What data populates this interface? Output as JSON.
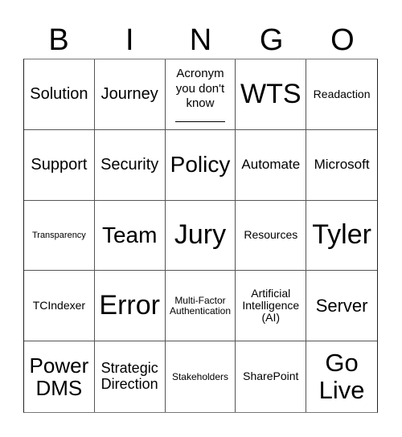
{
  "header": {
    "letters": [
      "B",
      "I",
      "N",
      "G",
      "O"
    ]
  },
  "board": {
    "rows": [
      [
        "Solution",
        "Journey",
        "Acronym you don't know",
        "WTS",
        "Readaction"
      ],
      [
        "Support",
        "Security",
        "Policy",
        "Automate",
        "Microsoft"
      ],
      [
        "Transparency",
        "Team",
        "Jury",
        "Resources",
        "Tyler"
      ],
      [
        "TCIndexer",
        "Error",
        "Multi-Factor Authentication",
        "Artificial Intelligence (AI)",
        "Server"
      ],
      [
        "Power DMS",
        "Strategic Direction",
        "Stakeholders",
        "SharePoint",
        "Go Live"
      ]
    ],
    "acronym_cell": {
      "line1": "Acronym",
      "line2": "you don't",
      "line3": "know",
      "blank": "________"
    }
  }
}
